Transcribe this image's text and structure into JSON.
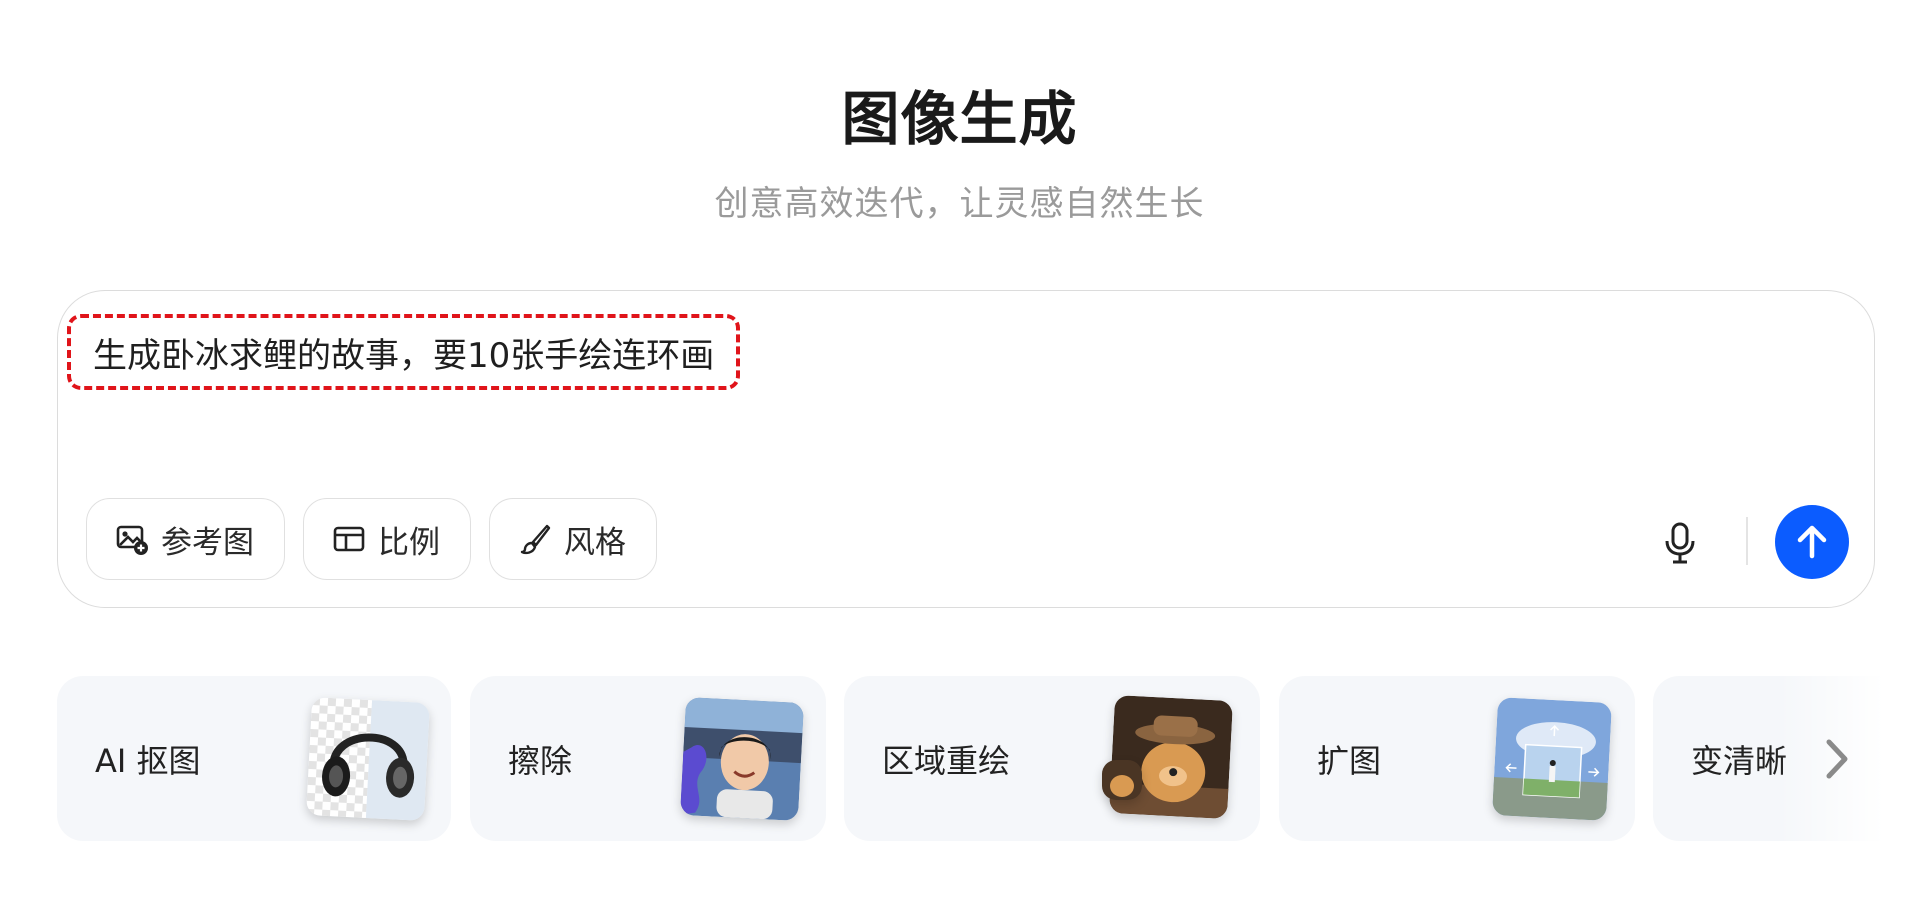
{
  "header": {
    "title": "图像生成",
    "subtitle": "创意高效迭代，让灵感自然生长"
  },
  "composer": {
    "prompt": "生成卧冰求鲤的故事，要10张手绘连环画",
    "tools": [
      {
        "label": "参考图",
        "icon": "image-add-icon"
      },
      {
        "label": "比例",
        "icon": "aspect-ratio-icon"
      },
      {
        "label": "风格",
        "icon": "brush-icon"
      }
    ],
    "mic_icon": "microphone-icon",
    "send_icon": "arrow-up-icon",
    "accent_color": "#0b5cff",
    "highlight_color": "#e0141a"
  },
  "features": [
    {
      "label": "AI 抠图"
    },
    {
      "label": "擦除"
    },
    {
      "label": "区域重绘"
    },
    {
      "label": "扩图"
    },
    {
      "label": "变清晰"
    }
  ]
}
